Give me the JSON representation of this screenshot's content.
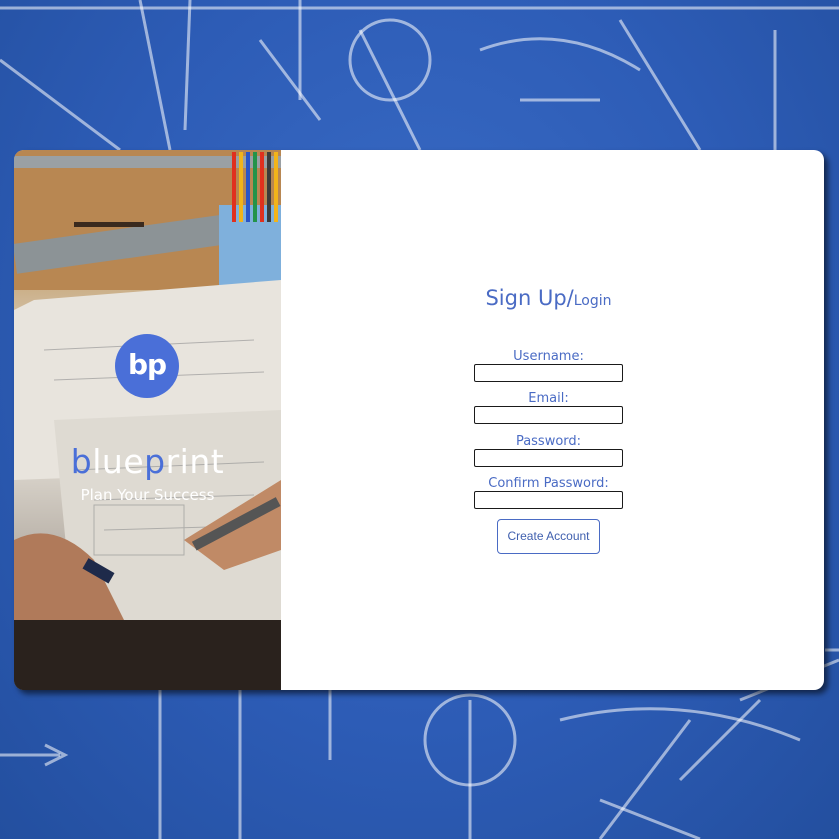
{
  "brand": {
    "logo_text": "bp",
    "wordmark_first_b": "b",
    "wordmark_lue": "lue",
    "wordmark_p": "p",
    "wordmark_rint": "rint",
    "tagline": "Plan Your Success"
  },
  "form": {
    "title": "Sign Up/",
    "login_link": "Login",
    "fields": [
      {
        "label": "Username:",
        "value": ""
      },
      {
        "label": "Email:",
        "value": ""
      },
      {
        "label": "Password:",
        "value": ""
      },
      {
        "label": "Confirm Password:",
        "value": ""
      }
    ],
    "submit_label": "Create Account"
  },
  "colors": {
    "accent": "#4a6bc4",
    "logo_blue": "#4a6fd8",
    "background_blue": "#2f5fb8"
  }
}
